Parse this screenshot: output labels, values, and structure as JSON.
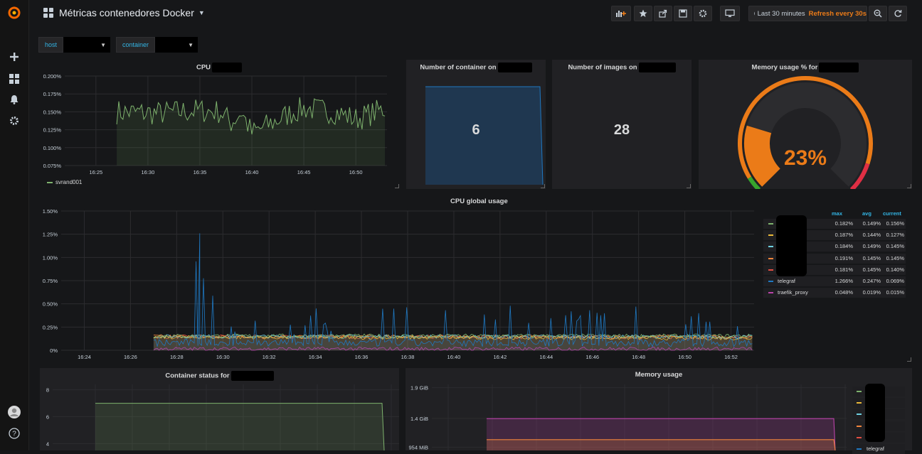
{
  "dashboard": {
    "title": "Métricas contenedores Docker"
  },
  "toolbar": {
    "time_range": "Last 30 minutes",
    "refresh": "Refresh every 30s",
    "icons": [
      "add-panel-icon",
      "star-icon",
      "share-icon",
      "save-icon",
      "settings-icon",
      "tv-mode-icon",
      "clock-icon",
      "zoom-out-icon",
      "refresh-icon"
    ]
  },
  "sidebar": {
    "icons": [
      "grafana-logo-icon",
      "plus-icon",
      "dashboards-icon",
      "alerting-icon",
      "gear-icon",
      "user-avatar-icon",
      "help-icon"
    ]
  },
  "variables": [
    {
      "label": "host",
      "value": ""
    },
    {
      "label": "container",
      "value": ""
    }
  ],
  "colors": {
    "accent": "#eb7b18",
    "link": "#33b5e5",
    "bg": "#161719",
    "panel": "#212124"
  },
  "panels": {
    "cpu": {
      "title": "CPU",
      "legend": "svrand001"
    },
    "containers": {
      "title": "Number of container on",
      "value": "6"
    },
    "images": {
      "title": "Number of images on",
      "value": "28"
    },
    "memory_gauge": {
      "title": "Memory usage % for",
      "value": "23%"
    },
    "cpu_global": {
      "title": "CPU global usage",
      "legend_headers": {
        "max": "max",
        "avg": "avg",
        "current": "current"
      },
      "legend_rows": [
        {
          "name": "",
          "color": "#7eb26d",
          "max": "0.182%",
          "avg": "0.149%",
          "current": "0.156%"
        },
        {
          "name": "",
          "color": "#eab839",
          "max": "0.187%",
          "avg": "0.144%",
          "current": "0.127%"
        },
        {
          "name": "",
          "color": "#6ed0e0",
          "max": "0.184%",
          "avg": "0.149%",
          "current": "0.145%"
        },
        {
          "name": "",
          "color": "#ef843c",
          "max": "0.191%",
          "avg": "0.145%",
          "current": "0.145%"
        },
        {
          "name": "",
          "color": "#e24d42",
          "max": "0.181%",
          "avg": "0.145%",
          "current": "0.140%"
        },
        {
          "name": "telegraf",
          "color": "#1f78c1",
          "max": "1.266%",
          "avg": "0.247%",
          "current": "0.069%"
        },
        {
          "name": "traefik_proxy",
          "color": "#ba43a9",
          "max": "0.048%",
          "avg": "0.019%",
          "current": "0.015%"
        }
      ]
    },
    "container_status": {
      "title": "Container status for"
    },
    "memory_usage": {
      "title": "Memory usage",
      "legend_rows": [
        {
          "name": "",
          "color": "#7eb26d"
        },
        {
          "name": "",
          "color": "#eab839"
        },
        {
          "name": "",
          "color": "#6ed0e0"
        },
        {
          "name": "",
          "color": "#ef843c"
        },
        {
          "name": "",
          "color": "#e24d42"
        },
        {
          "name": "telegraf",
          "color": "#1f78c1"
        }
      ]
    }
  },
  "chart_data": [
    {
      "id": "cpu",
      "type": "line",
      "ylim": [
        0.075,
        0.2
      ],
      "y_ticks": [
        "0.075%",
        "0.100%",
        "0.125%",
        "0.150%",
        "0.175%",
        "0.200%"
      ],
      "y_tick_values": [
        0.075,
        0.1,
        0.125,
        0.15,
        0.175,
        0.2
      ],
      "xlim": [
        "16:22",
        "16:53"
      ],
      "x_ticks": [
        "16:25",
        "16:30",
        "16:35",
        "16:40",
        "16:45",
        "16:50"
      ],
      "series": [
        {
          "name": "svrand001",
          "color": "#7eb26d",
          "x": [
            "16:27",
            "16:31",
            "16:35",
            "16:37",
            "16:38",
            "16:39",
            "16:40",
            "16:44",
            "16:45",
            "16:48",
            "16:50",
            "16:53"
          ],
          "values": [
            0.15,
            0.148,
            0.152,
            0.15,
            0.135,
            0.15,
            0.12,
            0.15,
            0.155,
            0.15,
            0.14,
            0.155
          ]
        }
      ]
    },
    {
      "id": "containers",
      "type": "area",
      "series": [
        {
          "name": "",
          "color": "#1f78c1",
          "values": [
            6,
            6,
            6,
            6,
            6,
            6,
            0
          ]
        }
      ]
    },
    {
      "id": "memory_gauge",
      "type": "gauge",
      "value": 23,
      "max": 100,
      "thresholds": [
        {
          "to": 5,
          "color": "#37a62d"
        },
        {
          "to": 90,
          "color": "#eb7b18"
        },
        {
          "to": 100,
          "color": "#e02f44"
        }
      ]
    },
    {
      "id": "cpu_global",
      "type": "line",
      "ylim": [
        0,
        1.5
      ],
      "y_ticks": [
        "0%",
        "0.25%",
        "0.50%",
        "0.75%",
        "1.00%",
        "1.25%",
        "1.50%"
      ],
      "y_tick_values": [
        0,
        0.25,
        0.5,
        0.75,
        1.0,
        1.25,
        1.5
      ],
      "xlim": [
        "16:23",
        "16:53"
      ],
      "x_ticks": [
        "16:24",
        "16:26",
        "16:28",
        "16:30",
        "16:32",
        "16:34",
        "16:36",
        "16:38",
        "16:40",
        "16:42",
        "16:44",
        "16:46",
        "16:48",
        "16:50",
        "16:52"
      ],
      "series": [
        {
          "name": "telegraf",
          "color": "#1f78c1",
          "x": [
            "16:27",
            "16:28",
            "16:29",
            "16:30",
            "16:31",
            "16:32",
            "16:34",
            "16:35",
            "16:36",
            "16:38",
            "16:40",
            "16:42",
            "16:44",
            "16:46",
            "16:48",
            "16:50",
            "16:52",
            "16:53"
          ],
          "values": [
            0.5,
            0.1,
            1.26,
            0.1,
            0.55,
            0.08,
            0.45,
            0.1,
            0.62,
            0.45,
            0.4,
            0.45,
            0.48,
            0.4,
            0.55,
            0.45,
            0.55,
            0.05
          ]
        },
        {
          "name": "traefik_proxy",
          "color": "#ba43a9",
          "x": [
            "16:27",
            "16:53"
          ],
          "values": [
            0.015,
            0.015
          ]
        },
        {
          "name": "",
          "color": "#7eb26d",
          "x": [
            "16:27",
            "16:53"
          ],
          "values": [
            0.156,
            0.156
          ]
        },
        {
          "name": "",
          "color": "#eab839",
          "x": [
            "16:27",
            "16:53"
          ],
          "values": [
            0.14,
            0.13
          ]
        },
        {
          "name": "",
          "color": "#6ed0e0",
          "x": [
            "16:27",
            "16:53"
          ],
          "values": [
            0.15,
            0.145
          ]
        },
        {
          "name": "",
          "color": "#ef843c",
          "x": [
            "16:27",
            "16:53"
          ],
          "values": [
            0.15,
            0.145
          ]
        },
        {
          "name": "",
          "color": "#e24d42",
          "x": [
            "16:27",
            "16:53"
          ],
          "values": [
            0.145,
            0.14
          ]
        }
      ]
    },
    {
      "id": "container_status",
      "type": "area",
      "y_ticks": [
        "4",
        "6",
        "8"
      ],
      "y_tick_values": [
        4,
        6,
        8
      ],
      "ylim": [
        3.5,
        8.4
      ],
      "series": [
        {
          "name": "",
          "color": "#7eb26d",
          "values": [
            7,
            7,
            7,
            7,
            7,
            0
          ]
        }
      ]
    },
    {
      "id": "memory_usage",
      "type": "area",
      "y_ticks": [
        "954 MiB",
        "1.4 GiB",
        "1.9 GiB"
      ],
      "y_tick_values": [
        954,
        1434,
        1946
      ],
      "ylim": [
        900,
        2000
      ],
      "series": [
        {
          "name": "telegraf",
          "color": "#ba43a9",
          "values": [
            1430,
            1430,
            1430,
            1430,
            0
          ]
        },
        {
          "name": "",
          "color": "#ef843c",
          "values": [
            1080,
            1080,
            1080,
            1080,
            0
          ]
        }
      ]
    }
  ]
}
